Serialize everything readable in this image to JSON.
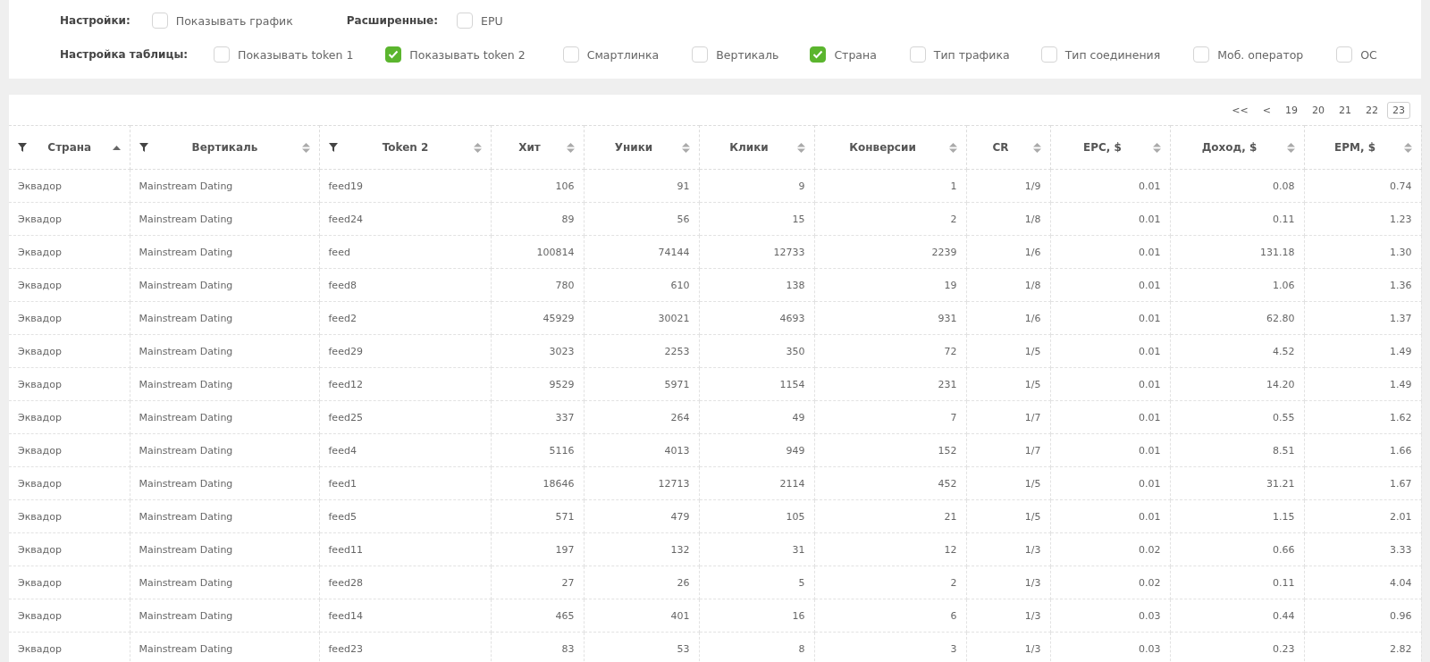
{
  "settings": [
    {
      "label": "Настройки:",
      "options": [
        {
          "label": "Показывать график",
          "checked": false
        }
      ],
      "extra_label": "Расширенные:",
      "extra_options": [
        {
          "label": "EPU",
          "checked": false
        }
      ]
    },
    {
      "label": "Настройка таблицы:",
      "options": [
        {
          "label": "Показывать token 1",
          "checked": false
        },
        {
          "label": "Показывать token 2",
          "checked": true
        },
        {
          "label": "Смартлинка",
          "checked": false
        },
        {
          "label": "Вертикаль",
          "checked": false
        },
        {
          "label": "Страна",
          "checked": true
        },
        {
          "label": "Тип трафика",
          "checked": false
        },
        {
          "label": "Тип соединения",
          "checked": false
        },
        {
          "label": "Моб. оператор",
          "checked": false
        },
        {
          "label": "ОС",
          "checked": false
        }
      ]
    }
  ],
  "pagination": [
    {
      "label": "<<",
      "selected": false
    },
    {
      "label": "<",
      "selected": false
    },
    {
      "label": "19",
      "selected": false
    },
    {
      "label": "20",
      "selected": false
    },
    {
      "label": "21",
      "selected": false
    },
    {
      "label": "22",
      "selected": false
    },
    {
      "label": "23",
      "selected": true
    }
  ],
  "table": {
    "columns": [
      {
        "label": "Страна",
        "filter": true,
        "sorted": true
      },
      {
        "label": "Вертикаль",
        "filter": true,
        "sorted": false
      },
      {
        "label": "Token 2",
        "filter": true,
        "sorted": false
      },
      {
        "label": "Хит",
        "filter": false,
        "sorted": false
      },
      {
        "label": "Уники",
        "filter": false,
        "sorted": false
      },
      {
        "label": "Клики",
        "filter": false,
        "sorted": false
      },
      {
        "label": "Конверсии",
        "filter": false,
        "sorted": false
      },
      {
        "label": "CR",
        "filter": false,
        "sorted": false
      },
      {
        "label": "EPC, $",
        "filter": false,
        "sorted": false
      },
      {
        "label": "Доход, $",
        "filter": false,
        "sorted": false
      },
      {
        "label": "EPM, $",
        "filter": false,
        "sorted": false
      }
    ],
    "rows": [
      [
        "Эквадор",
        "Mainstream Dating",
        "feed19",
        "106",
        "91",
        "9",
        "1",
        "1/9",
        "0.01",
        "0.08",
        "0.74"
      ],
      [
        "Эквадор",
        "Mainstream Dating",
        "feed24",
        "89",
        "56",
        "15",
        "2",
        "1/8",
        "0.01",
        "0.11",
        "1.23"
      ],
      [
        "Эквадор",
        "Mainstream Dating",
        "feed",
        "100814",
        "74144",
        "12733",
        "2239",
        "1/6",
        "0.01",
        "131.18",
        "1.30"
      ],
      [
        "Эквадор",
        "Mainstream Dating",
        "feed8",
        "780",
        "610",
        "138",
        "19",
        "1/8",
        "0.01",
        "1.06",
        "1.36"
      ],
      [
        "Эквадор",
        "Mainstream Dating",
        "feed2",
        "45929",
        "30021",
        "4693",
        "931",
        "1/6",
        "0.01",
        "62.80",
        "1.37"
      ],
      [
        "Эквадор",
        "Mainstream Dating",
        "feed29",
        "3023",
        "2253",
        "350",
        "72",
        "1/5",
        "0.01",
        "4.52",
        "1.49"
      ],
      [
        "Эквадор",
        "Mainstream Dating",
        "feed12",
        "9529",
        "5971",
        "1154",
        "231",
        "1/5",
        "0.01",
        "14.20",
        "1.49"
      ],
      [
        "Эквадор",
        "Mainstream Dating",
        "feed25",
        "337",
        "264",
        "49",
        "7",
        "1/7",
        "0.01",
        "0.55",
        "1.62"
      ],
      [
        "Эквадор",
        "Mainstream Dating",
        "feed4",
        "5116",
        "4013",
        "949",
        "152",
        "1/7",
        "0.01",
        "8.51",
        "1.66"
      ],
      [
        "Эквадор",
        "Mainstream Dating",
        "feed1",
        "18646",
        "12713",
        "2114",
        "452",
        "1/5",
        "0.01",
        "31.21",
        "1.67"
      ],
      [
        "Эквадор",
        "Mainstream Dating",
        "feed5",
        "571",
        "479",
        "105",
        "21",
        "1/5",
        "0.01",
        "1.15",
        "2.01"
      ],
      [
        "Эквадор",
        "Mainstream Dating",
        "feed11",
        "197",
        "132",
        "31",
        "12",
        "1/3",
        "0.02",
        "0.66",
        "3.33"
      ],
      [
        "Эквадор",
        "Mainstream Dating",
        "feed28",
        "27",
        "26",
        "5",
        "2",
        "1/3",
        "0.02",
        "0.11",
        "4.04"
      ],
      [
        "Эквадор",
        "Mainstream Dating",
        "feed14",
        "465",
        "401",
        "16",
        "6",
        "1/3",
        "0.03",
        "0.44",
        "0.96"
      ],
      [
        "Эквадор",
        "Mainstream Dating",
        "feed23",
        "83",
        "53",
        "8",
        "3",
        "1/3",
        "0.03",
        "0.23",
        "2.82"
      ]
    ]
  }
}
